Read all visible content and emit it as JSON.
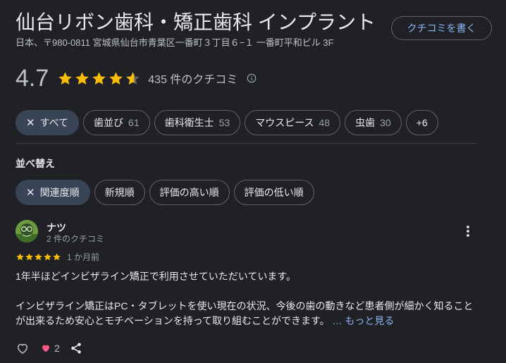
{
  "place": {
    "name": "仙台リボン歯科・矯正歯科 インプラント",
    "address": "日本、〒980-0811 宮城県仙台市青葉区一番町３丁目６−１ 一番町平和ビル 3F",
    "write_review_label": "クチコミを書く"
  },
  "rating": {
    "value": "4.7",
    "stars": 4.7,
    "review_count_label": "435 件のクチコミ"
  },
  "topics": [
    {
      "label": "すべて",
      "count": "",
      "selected": true
    },
    {
      "label": "歯並び",
      "count": "61",
      "selected": false
    },
    {
      "label": "歯科衛生士",
      "count": "53",
      "selected": false
    },
    {
      "label": "マウスピース",
      "count": "48",
      "selected": false
    },
    {
      "label": "虫歯",
      "count": "30",
      "selected": false
    },
    {
      "label": "+6",
      "count": "",
      "selected": false
    }
  ],
  "sort": {
    "label": "並べ替え",
    "options": [
      {
        "label": "関連度順",
        "selected": true
      },
      {
        "label": "新規順",
        "selected": false
      },
      {
        "label": "評価の高い順",
        "selected": false
      },
      {
        "label": "評価の低い順",
        "selected": false
      }
    ]
  },
  "review": {
    "author": "ナツ",
    "author_sub": "2 件のクチコミ",
    "stars": 5,
    "date": "1 か月前",
    "paragraph1": "1年半ほどインビザライン矯正で利用させていただいています。",
    "paragraph2": "インビザライン矯正はPC・タブレットを使い現在の状況、今後の歯の動きなど患者側が細かく知ることが出来るため安心とモチベーションを持って取り組むことができます。",
    "more_label": "… もっと見る",
    "likes": "2"
  },
  "colors": {
    "background": "#202124",
    "star": "#fbbc04",
    "link": "#8ab4f8",
    "selected_chip": "#394457",
    "heart": "#ff5a8a"
  },
  "icons": [
    "star-icon",
    "info-icon",
    "close-icon",
    "more-vert-icon",
    "thumb-up-outline-icon",
    "heart-icon",
    "share-icon"
  ]
}
